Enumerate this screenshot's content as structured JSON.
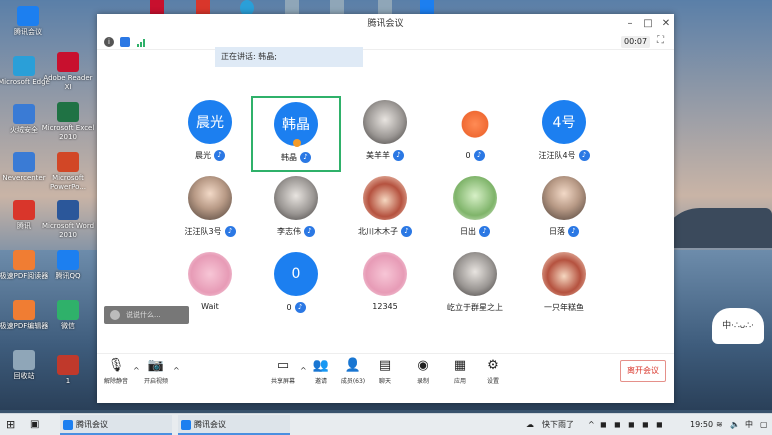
{
  "desktop": {
    "icons": [
      {
        "label": "腾讯会议",
        "color": "#1c7ff0"
      },
      {
        "label": "Microsoft Edge",
        "color": "#2a9fd8"
      },
      {
        "label": "火绒安全",
        "color": "#f07d33"
      },
      {
        "label": "Nevercenter",
        "color": "#3a7bd5"
      },
      {
        "label": "腾讯",
        "color": "#d9362b"
      },
      {
        "label": "极速PDF阅读器",
        "color": "#f07d33"
      },
      {
        "label": "极速PDF编辑器",
        "color": "#f07d33"
      },
      {
        "label": "回收站",
        "color": "#8fa6b8"
      },
      {
        "label": "Adobe Reader XI",
        "color": "#c8102e"
      },
      {
        "label": "Microsoft Excel 2010",
        "color": "#1f7244"
      },
      {
        "label": "Microsoft PowerPo...",
        "color": "#d24726"
      },
      {
        "label": "Microsoft Word 2010",
        "color": "#2b579a"
      },
      {
        "label": "腾讯QQ",
        "color": "#1c7ff0"
      },
      {
        "label": "微信",
        "color": "#2fb16a"
      },
      {
        "label": "1",
        "color": "#c0392b"
      }
    ]
  },
  "window": {
    "title": "腾讯会议",
    "controls": {
      "minimize": "–",
      "maximize": "□",
      "close": "✕"
    },
    "timer": "00:07",
    "speaking_text": "正在讲话: 韩晶;"
  },
  "participants": [
    {
      "name": "晨光",
      "avatar_text": "晨光"
    },
    {
      "name": "韩晶",
      "avatar_text": "韩晶"
    },
    {
      "name": "美羊羊",
      "avatar_text": ""
    },
    {
      "name": "0",
      "avatar_text": ""
    },
    {
      "name": "汪汪队4号",
      "avatar_text": "4号"
    },
    {
      "name": "汪汪队3号",
      "avatar_text": ""
    },
    {
      "name": "李志伟",
      "avatar_text": ""
    },
    {
      "name": "北川木木子",
      "avatar_text": ""
    },
    {
      "name": "日出",
      "avatar_text": ""
    },
    {
      "name": "日落",
      "avatar_text": ""
    },
    {
      "name": "Wait",
      "avatar_text": ""
    },
    {
      "name": "0",
      "avatar_text": "0"
    },
    {
      "name": "12345",
      "avatar_text": ""
    },
    {
      "name": "屹立于群星之上",
      "avatar_text": ""
    },
    {
      "name": "一只年糕鱼",
      "avatar_text": ""
    }
  ],
  "chat_float": "说说什么...",
  "toolbar": {
    "mute": "解除静音",
    "video": "开启视频",
    "share": "共享屏幕",
    "invite": "邀请",
    "members": "成员(63)",
    "chat": "聊天",
    "record": "录制",
    "apps": "应用",
    "settings": "设置",
    "leave": "离开会议"
  },
  "taskbar": {
    "apps": [
      "腾讯会议",
      "腾讯会议"
    ],
    "weather": "快下雨了",
    "time": "19:50"
  },
  "colors": {
    "accent": "#1c7ff0",
    "active_border": "#2fb16a",
    "leave": "#d9362b"
  }
}
